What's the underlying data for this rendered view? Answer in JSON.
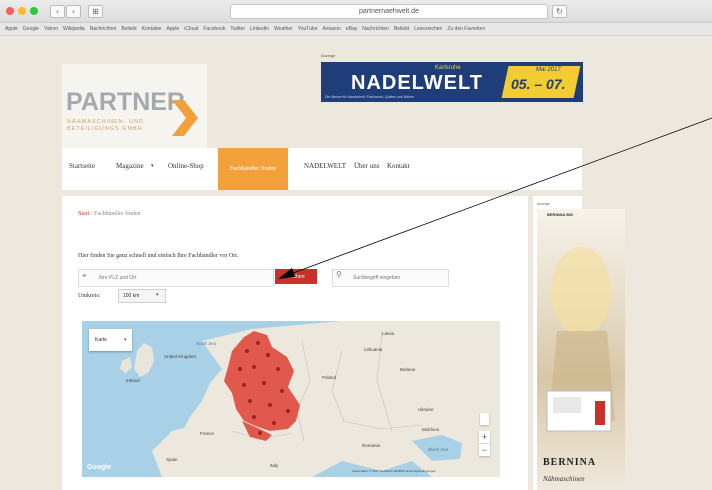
{
  "browser": {
    "url": "partnernaehwelt.de",
    "bookmarks": [
      "Apple",
      "Google",
      "Yahoo",
      "Wikipedia",
      "Nachrichten",
      "Beliebt",
      "Kontakte",
      "Apple",
      "iCloud",
      "Facebook",
      "Twitter",
      "LinkedIn",
      "Weather",
      "YouTube",
      "Amazon",
      "eBay",
      "Nachrichten",
      "Beliebt",
      "Lesezeichen",
      "Zu den Favoriten"
    ],
    "tab_icon": "⊞"
  },
  "header": {
    "logo_text": "PARTNER",
    "logo_subtext": "NÄHMASCHINEN- UND BETEILIGUNGS GMBH",
    "ad_label": "Anzeige",
    "banner": {
      "subtitle": "Karlsruhe",
      "title": "NADELWELT",
      "tagline": "Die Messe für Handarbeit, Patchwork, Quilten und Nähen",
      "month": "Mai 2017",
      "days": "05. – 07."
    }
  },
  "nav": {
    "items": [
      "Startseite",
      "Magazine",
      "Online-Shop",
      "Fachhändler finden",
      "NADELWELT",
      "Über uns",
      "Kontakt"
    ],
    "active_index": 3
  },
  "main": {
    "breadcrumb_home": "Start",
    "breadcrumb_current": "Fachhändler finden",
    "intro": "Hier finden Sie ganz schnell und einfach Ihre Fachhändler vor Ort.",
    "location_placeholder": "Ihre PLZ und Ort",
    "search_button": "Suchen",
    "text_placeholder": "Suchbegriff eingeben",
    "distance_label": "Umkreis:",
    "distance_value": "100 km",
    "map": {
      "type_select": "Karte",
      "labels": [
        {
          "text": "United Kingdom",
          "kind": "country"
        },
        {
          "text": "Ireland",
          "kind": "country"
        },
        {
          "text": "North Sea",
          "kind": "water"
        },
        {
          "text": "Latvia",
          "kind": "country"
        },
        {
          "text": "Lithuania",
          "kind": "country"
        },
        {
          "text": "Belarus",
          "kind": "country"
        },
        {
          "text": "Poland",
          "kind": "country"
        },
        {
          "text": "Ukraine",
          "kind": "country"
        },
        {
          "text": "France",
          "kind": "country"
        },
        {
          "text": "Romania",
          "kind": "country"
        },
        {
          "text": "Moldova",
          "kind": "country"
        },
        {
          "text": "Spain",
          "kind": "country"
        },
        {
          "text": "Italy",
          "kind": "country"
        },
        {
          "text": "Black Sea",
          "kind": "water"
        }
      ],
      "zoom_in": "+",
      "zoom_out": "−",
      "google": "Google",
      "terms": "Kartendaten © 2017 GeoBasis-DE/BKG  Nutzungsbedingungen"
    }
  },
  "sidebar": {
    "ad_label": "Anzeige",
    "ad_logo": "BERNINA 580",
    "ad_brand": "BERNINA",
    "ad_script": "Nähmaschinen"
  }
}
